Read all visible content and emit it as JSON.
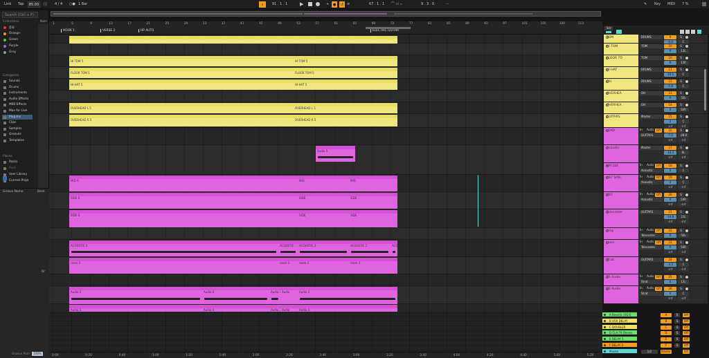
{
  "transport": {
    "link": "Link",
    "tap": "Tap",
    "tempo": "85.00",
    "signature": "4 / 4",
    "quant": "1 Bar",
    "pos": "91 . 1 . 1",
    "loop_start": "67 . 1 . 1",
    "loop_len": "9 . 3 . 0",
    "key": "Key",
    "midi": "MIDI",
    "cpu": "7 %"
  },
  "browser": {
    "search": "Search (Ctrl + F)",
    "collections_label": "Collections",
    "collections": [
      {
        "name": "중요",
        "color": "#e33"
      },
      {
        "name": "Orange",
        "color": "#f39c1f"
      },
      {
        "name": "Green",
        "color": "#4c4"
      },
      {
        "name": "Purple",
        "color": "#a6d"
      },
      {
        "name": "Gray",
        "color": "#999"
      }
    ],
    "categories_label": "Categories",
    "categories": [
      "Sounds",
      "Drums",
      "Instruments",
      "Audio Effects",
      "MIDI Effects",
      "Max for Live",
      "Plug-Ins",
      "Clips",
      "Samples",
      "Grooves",
      "Templates"
    ],
    "places_label": "Places",
    "places": [
      "Packs",
      "Push",
      "User Library",
      "Current Proje"
    ],
    "col_name": "Nam",
    "groove_name": "Groove Name",
    "groove_base": "Base",
    "groove_pool": "Groove Pool",
    "zoom": "100%",
    "dr": "Dr"
  },
  "locators": [
    "HOOK 1",
    "VERSE 2",
    "HP AUTO",
    "ELECTRIC GUITAR"
  ],
  "bars": [
    "1",
    "5",
    "9",
    "13",
    "17",
    "21",
    "25",
    "29",
    "33",
    "37",
    "41",
    "45",
    "49",
    "53",
    "57",
    "61",
    "65",
    "69",
    "73",
    "77",
    "81",
    "85",
    "89",
    "93",
    "97",
    "101",
    "105",
    "109",
    "113"
  ],
  "times": [
    "0:00",
    "0:20",
    "0:40",
    "1:00",
    "1:20",
    "1:40",
    "2:00",
    "2:20",
    "2:40",
    "3:00",
    "3:20",
    "3:40",
    "4:00",
    "4:20",
    "4:40",
    "5:00",
    "5:20"
  ],
  "clips": {
    "htom_a": "HI TOM 5",
    "htom_b": "HI TOM 5",
    "floor_a": "FLOOR TOM 5",
    "floor_b": "FLOOR TOM 5",
    "hihat_a": "HI-HAT 5",
    "hihat_b": "HI-HAT 5",
    "ovl_a": "OVERHEAD L 5",
    "ovl_b": "OVERHEAD L 5",
    "ovr_a": "OVERHEAD R 5",
    "ovr_b": "OVERHEAD R 5",
    "lead": "Audio 5",
    "mid_a": "MID 6",
    "mid_b": "MID",
    "mid_c": "MID",
    "side_a": "SIDE 6",
    "side_b": "SIDE",
    "side_c": "SIDE",
    "side2_a": "SIDE 6",
    "side2_b": "SIDE",
    "side2_c": "SIDE",
    "ac_a": "ACOUSTIC 5",
    "ac_b": "ACOUSTIC",
    "ac_c": "ACOUSTIC 2",
    "ac_d": "ACOUSTIC 2",
    "ac_e": "ACO",
    "room_a": "room 3",
    "room_b": "room 3",
    "room_c": "room 3",
    "room_d": "room 3",
    "au_a": "Audio 3",
    "au_b": "Audio 4",
    "au_c": "Audio 3",
    "au_d": "Audio",
    "au_e": "Audio 3",
    "au2_a": "Audio 3",
    "au2_b": "Audio 4",
    "au2_c": "Audio 3",
    "au2_d": "Audio",
    "au2_e": "Audio 3"
  },
  "set_label": "Set",
  "mixer": [
    {
      "name": "TOM",
      "route": "DRUMS",
      "num": "9",
      "vol": "-6.4",
      "pan": "C"
    },
    {
      "name": "HI TOM",
      "route": "TOM",
      "num": "10",
      "vol": "0",
      "pan": "13L"
    },
    {
      "name": "FLOOR TO",
      "route": "TOM",
      "num": "10",
      "vol": "0",
      "pan": "13R"
    },
    {
      "name": "HI-HAT",
      "route": "DRUMS",
      "num": "11",
      "vol": "-10.1",
      "pan": "C"
    },
    {
      "name": "OH",
      "route": "DRUMS",
      "num": "12",
      "vol": "-5.8",
      "pan": "C"
    },
    {
      "name": "OVERHEA",
      "route": "OH",
      "num": "13",
      "vol": "0",
      "pan": "50L"
    },
    {
      "name": "OVERHEA",
      "route": "OH",
      "num": "14",
      "vol": "0",
      "pan": "50R"
    },
    {
      "name": "GUITARS",
      "route": "Master",
      "num": "15",
      "vol": "0",
      "pan": "C"
    },
    {
      "name": "LEAD",
      "route": "GUITARS",
      "num": "16",
      "vol": "-7.5",
      "pan": "-28.0"
    },
    {
      "name": "Acoustic",
      "route": "Master",
      "num": "17",
      "vol": "-16.3",
      "pan": "6L"
    },
    {
      "name": "KM 184",
      "route": "Acoustic",
      "num": "18",
      "vol": "0",
      "pan": "C"
    },
    {
      "name": "U87 SIDE",
      "route": "Acoustic",
      "num": "19",
      "vol": "0",
      "pan": "C"
    },
    {
      "name": "U87",
      "route": "Acoustic",
      "num": "20",
      "vol": "0",
      "pan": "50R"
    },
    {
      "name": "Telecaster",
      "route": "GUITARS",
      "num": "21",
      "vol": "-14.8",
      "pan": "21L"
    },
    {
      "name": "Amp",
      "route": "Telecaster",
      "num": "22",
      "vol": "0",
      "pan": "50L"
    },
    {
      "name": "room",
      "route": "Telecaster",
      "num": "23",
      "vol": "0",
      "pan": "50R"
    },
    {
      "name": "Strat",
      "route": "GUITARS",
      "num": "24",
      "vol": "-4.3",
      "pan": "C"
    },
    {
      "name": "25 Audio",
      "route": "Strat",
      "num": "25",
      "vol": "0",
      "pan": "12L"
    },
    {
      "name": "26 Audio",
      "route": "Strat",
      "num": "26",
      "vol": "0",
      "pan": "C"
    }
  ],
  "returns": [
    {
      "name": "A Reverb | EQ E",
      "color": "#6ce06c"
    },
    {
      "name": "B VOX DELAY",
      "color": "#f0e060"
    },
    {
      "name": "C DOUBLER",
      "color": "#f0e060"
    },
    {
      "name": "D CLA-76 Stereo",
      "color": "#6ce06c"
    },
    {
      "name": "E DELAY 1",
      "color": "#6ce06c"
    },
    {
      "name": "F DELAY 2",
      "color": "#f39c1f"
    },
    {
      "name": "Master",
      "color": "#5ad7d7"
    }
  ],
  "return_letters": [
    "A",
    "B",
    "C",
    "D",
    "E",
    "F"
  ],
  "master_route": "1/2",
  "in_label": "In",
  "auto_label": "Auto",
  "off_label": "Off",
  "s_label": "S",
  "inf": "-inf",
  "master_out": "Master"
}
